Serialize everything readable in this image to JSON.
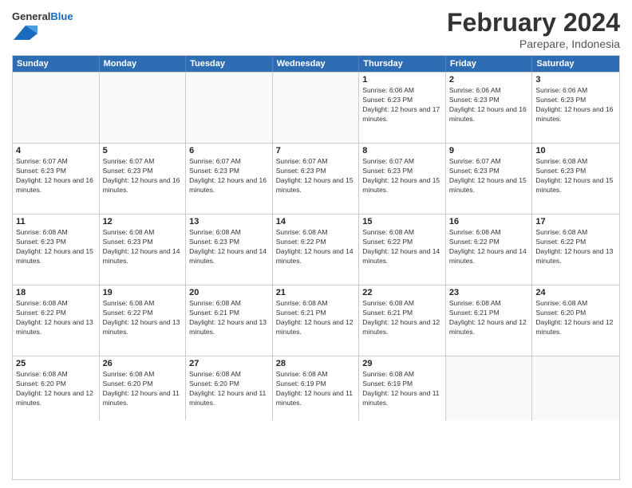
{
  "header": {
    "logo_general": "General",
    "logo_blue": "Blue",
    "month_title": "February 2024",
    "location": "Parepare, Indonesia"
  },
  "weekdays": [
    "Sunday",
    "Monday",
    "Tuesday",
    "Wednesday",
    "Thursday",
    "Friday",
    "Saturday"
  ],
  "weeks": [
    [
      {
        "day": "",
        "sunrise": "",
        "sunset": "",
        "daylight": "",
        "empty": true
      },
      {
        "day": "",
        "sunrise": "",
        "sunset": "",
        "daylight": "",
        "empty": true
      },
      {
        "day": "",
        "sunrise": "",
        "sunset": "",
        "daylight": "",
        "empty": true
      },
      {
        "day": "",
        "sunrise": "",
        "sunset": "",
        "daylight": "",
        "empty": true
      },
      {
        "day": "1",
        "sunrise": "Sunrise: 6:06 AM",
        "sunset": "Sunset: 6:23 PM",
        "daylight": "Daylight: 12 hours and 17 minutes.",
        "empty": false
      },
      {
        "day": "2",
        "sunrise": "Sunrise: 6:06 AM",
        "sunset": "Sunset: 6:23 PM",
        "daylight": "Daylight: 12 hours and 16 minutes.",
        "empty": false
      },
      {
        "day": "3",
        "sunrise": "Sunrise: 6:06 AM",
        "sunset": "Sunset: 6:23 PM",
        "daylight": "Daylight: 12 hours and 16 minutes.",
        "empty": false
      }
    ],
    [
      {
        "day": "4",
        "sunrise": "Sunrise: 6:07 AM",
        "sunset": "Sunset: 6:23 PM",
        "daylight": "Daylight: 12 hours and 16 minutes.",
        "empty": false
      },
      {
        "day": "5",
        "sunrise": "Sunrise: 6:07 AM",
        "sunset": "Sunset: 6:23 PM",
        "daylight": "Daylight: 12 hours and 16 minutes.",
        "empty": false
      },
      {
        "day": "6",
        "sunrise": "Sunrise: 6:07 AM",
        "sunset": "Sunset: 6:23 PM",
        "daylight": "Daylight: 12 hours and 16 minutes.",
        "empty": false
      },
      {
        "day": "7",
        "sunrise": "Sunrise: 6:07 AM",
        "sunset": "Sunset: 6:23 PM",
        "daylight": "Daylight: 12 hours and 15 minutes.",
        "empty": false
      },
      {
        "day": "8",
        "sunrise": "Sunrise: 6:07 AM",
        "sunset": "Sunset: 6:23 PM",
        "daylight": "Daylight: 12 hours and 15 minutes.",
        "empty": false
      },
      {
        "day": "9",
        "sunrise": "Sunrise: 6:07 AM",
        "sunset": "Sunset: 6:23 PM",
        "daylight": "Daylight: 12 hours and 15 minutes.",
        "empty": false
      },
      {
        "day": "10",
        "sunrise": "Sunrise: 6:08 AM",
        "sunset": "Sunset: 6:23 PM",
        "daylight": "Daylight: 12 hours and 15 minutes.",
        "empty": false
      }
    ],
    [
      {
        "day": "11",
        "sunrise": "Sunrise: 6:08 AM",
        "sunset": "Sunset: 6:23 PM",
        "daylight": "Daylight: 12 hours and 15 minutes.",
        "empty": false
      },
      {
        "day": "12",
        "sunrise": "Sunrise: 6:08 AM",
        "sunset": "Sunset: 6:23 PM",
        "daylight": "Daylight: 12 hours and 14 minutes.",
        "empty": false
      },
      {
        "day": "13",
        "sunrise": "Sunrise: 6:08 AM",
        "sunset": "Sunset: 6:23 PM",
        "daylight": "Daylight: 12 hours and 14 minutes.",
        "empty": false
      },
      {
        "day": "14",
        "sunrise": "Sunrise: 6:08 AM",
        "sunset": "Sunset: 6:22 PM",
        "daylight": "Daylight: 12 hours and 14 minutes.",
        "empty": false
      },
      {
        "day": "15",
        "sunrise": "Sunrise: 6:08 AM",
        "sunset": "Sunset: 6:22 PM",
        "daylight": "Daylight: 12 hours and 14 minutes.",
        "empty": false
      },
      {
        "day": "16",
        "sunrise": "Sunrise: 6:08 AM",
        "sunset": "Sunset: 6:22 PM",
        "daylight": "Daylight: 12 hours and 14 minutes.",
        "empty": false
      },
      {
        "day": "17",
        "sunrise": "Sunrise: 6:08 AM",
        "sunset": "Sunset: 6:22 PM",
        "daylight": "Daylight: 12 hours and 13 minutes.",
        "empty": false
      }
    ],
    [
      {
        "day": "18",
        "sunrise": "Sunrise: 6:08 AM",
        "sunset": "Sunset: 6:22 PM",
        "daylight": "Daylight: 12 hours and 13 minutes.",
        "empty": false
      },
      {
        "day": "19",
        "sunrise": "Sunrise: 6:08 AM",
        "sunset": "Sunset: 6:22 PM",
        "daylight": "Daylight: 12 hours and 13 minutes.",
        "empty": false
      },
      {
        "day": "20",
        "sunrise": "Sunrise: 6:08 AM",
        "sunset": "Sunset: 6:21 PM",
        "daylight": "Daylight: 12 hours and 13 minutes.",
        "empty": false
      },
      {
        "day": "21",
        "sunrise": "Sunrise: 6:08 AM",
        "sunset": "Sunset: 6:21 PM",
        "daylight": "Daylight: 12 hours and 12 minutes.",
        "empty": false
      },
      {
        "day": "22",
        "sunrise": "Sunrise: 6:08 AM",
        "sunset": "Sunset: 6:21 PM",
        "daylight": "Daylight: 12 hours and 12 minutes.",
        "empty": false
      },
      {
        "day": "23",
        "sunrise": "Sunrise: 6:08 AM",
        "sunset": "Sunset: 6:21 PM",
        "daylight": "Daylight: 12 hours and 12 minutes.",
        "empty": false
      },
      {
        "day": "24",
        "sunrise": "Sunrise: 6:08 AM",
        "sunset": "Sunset: 6:20 PM",
        "daylight": "Daylight: 12 hours and 12 minutes.",
        "empty": false
      }
    ],
    [
      {
        "day": "25",
        "sunrise": "Sunrise: 6:08 AM",
        "sunset": "Sunset: 6:20 PM",
        "daylight": "Daylight: 12 hours and 12 minutes.",
        "empty": false
      },
      {
        "day": "26",
        "sunrise": "Sunrise: 6:08 AM",
        "sunset": "Sunset: 6:20 PM",
        "daylight": "Daylight: 12 hours and 11 minutes.",
        "empty": false
      },
      {
        "day": "27",
        "sunrise": "Sunrise: 6:08 AM",
        "sunset": "Sunset: 6:20 PM",
        "daylight": "Daylight: 12 hours and 11 minutes.",
        "empty": false
      },
      {
        "day": "28",
        "sunrise": "Sunrise: 6:08 AM",
        "sunset": "Sunset: 6:19 PM",
        "daylight": "Daylight: 12 hours and 11 minutes.",
        "empty": false
      },
      {
        "day": "29",
        "sunrise": "Sunrise: 6:08 AM",
        "sunset": "Sunset: 6:19 PM",
        "daylight": "Daylight: 12 hours and 11 minutes.",
        "empty": false
      },
      {
        "day": "",
        "sunrise": "",
        "sunset": "",
        "daylight": "",
        "empty": true
      },
      {
        "day": "",
        "sunrise": "",
        "sunset": "",
        "daylight": "",
        "empty": true
      }
    ]
  ]
}
